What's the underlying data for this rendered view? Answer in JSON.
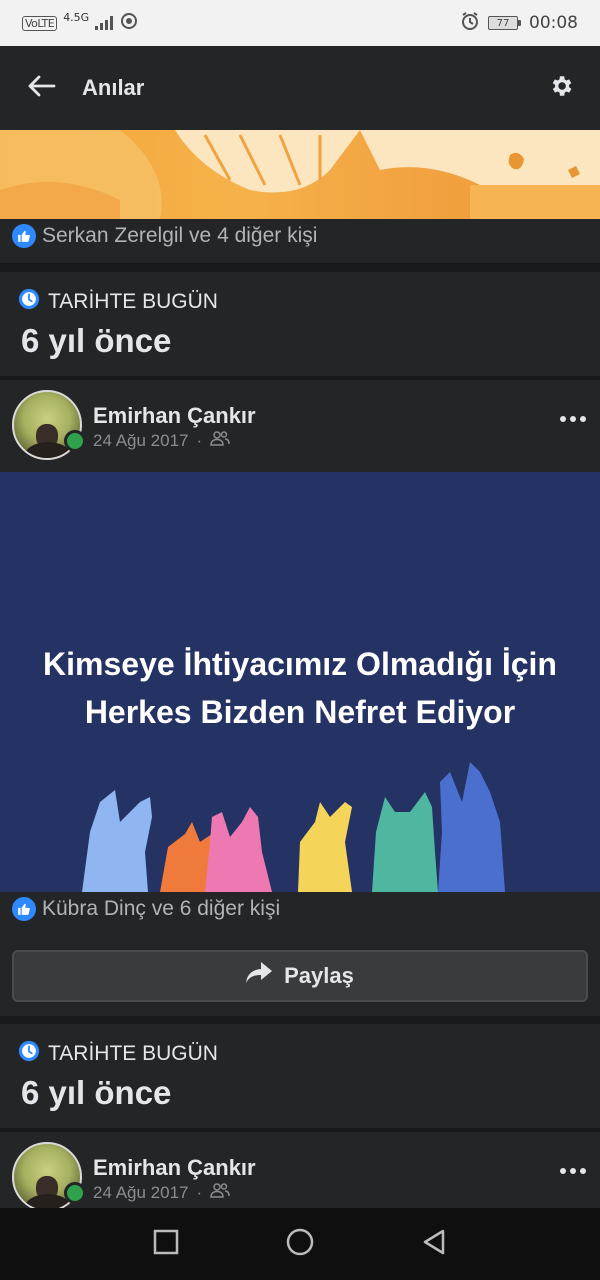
{
  "status_bar": {
    "volte": "VoLTE",
    "network": "4.5G",
    "battery": "77",
    "time": "00:08"
  },
  "header": {
    "title": "Anılar"
  },
  "first_memory": {
    "likes_text": "Serkan Zerelgil ve 4 diğer kişi"
  },
  "sections": [
    {
      "label": "TARİHTE BUGÜN",
      "years_ago": "6 yıl önce",
      "post": {
        "author": "Emirhan Çankır",
        "date": "24 Ağu 2017",
        "separator": "·",
        "image_text_line1": "Kimseye İhtiyacımız Olmadığı İçin",
        "image_text_line2": "Herkes Bizden Nefret Ediyor",
        "likes_text": "Kübra Dinç ve 6 diğer kişi",
        "share_label": "Paylaş"
      }
    },
    {
      "label": "TARİHTE BUGÜN",
      "years_ago": "6 yıl önce",
      "post": {
        "author": "Emirhan Çankır",
        "date": "24 Ağu 2017",
        "separator": "·"
      }
    }
  ],
  "colors": {
    "background": "#18191a",
    "card": "#242526",
    "like_blue": "#2e89ff",
    "online_green": "#31a24c",
    "post_image_bg": "#243264",
    "banner_orange": "#f2a53a"
  }
}
